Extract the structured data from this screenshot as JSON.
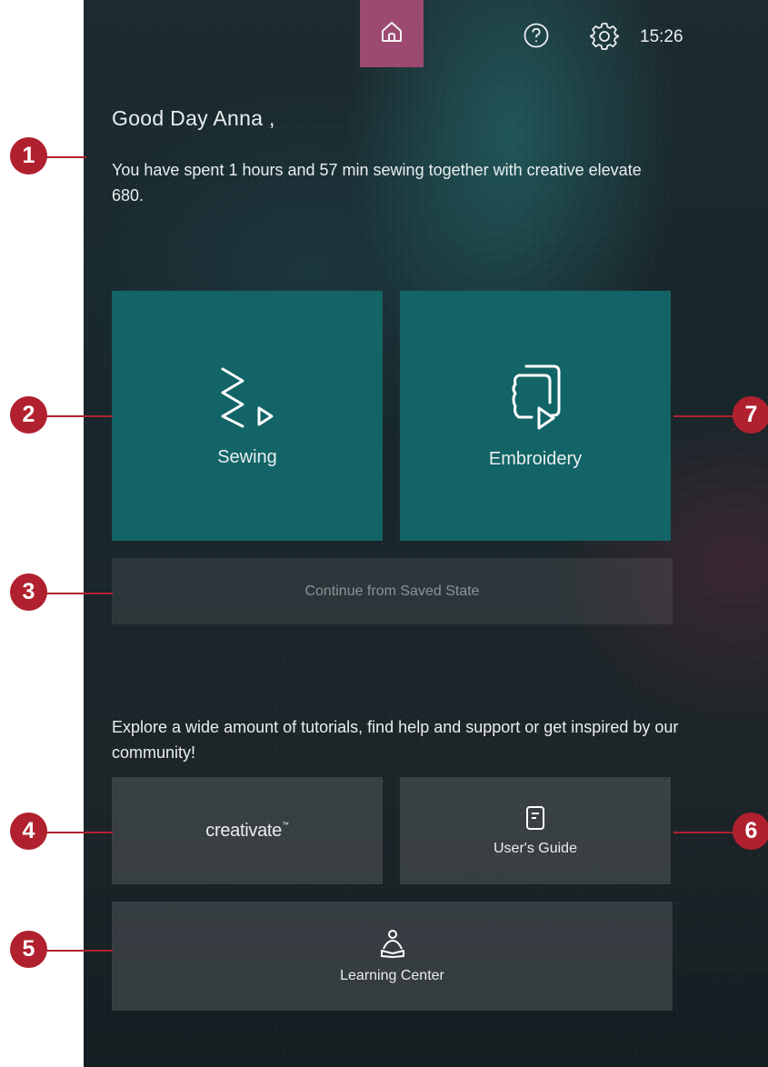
{
  "status_bar": {
    "time": "15:26"
  },
  "greeting": "Good Day Anna ,",
  "usage_message": "You have spent 1 hours and 57 min sewing together with creative elevate 680.",
  "tiles": {
    "sewing": "Sewing",
    "embroidery": "Embroidery",
    "continue": "Continue from Saved State"
  },
  "explore_text": "Explore a wide amount of tutorials, find help and support or get inspired by our community!",
  "links": {
    "creativate": "creativate",
    "creativate_tm": "™",
    "users_guide": "User's Guide",
    "learning_center": "Learning Center"
  },
  "callouts": [
    "1",
    "2",
    "3",
    "4",
    "5",
    "6",
    "7"
  ],
  "colors": {
    "accent_tab": "#9c4a70",
    "tile_teal": "#136466",
    "callout_red": "#b0202e"
  },
  "icons": [
    "home-icon",
    "help-icon",
    "settings-icon",
    "sewing-icon",
    "embroidery-icon",
    "book-icon",
    "learning-icon"
  ]
}
